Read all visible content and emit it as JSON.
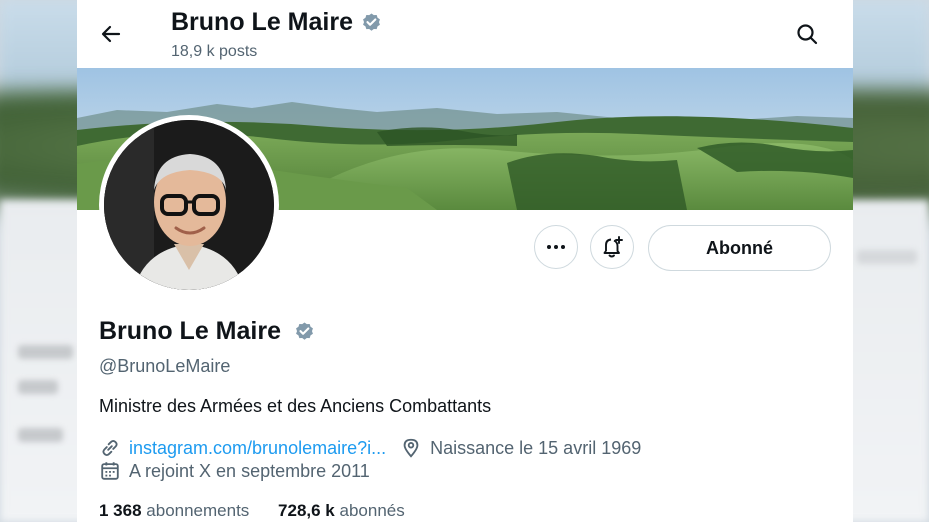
{
  "header": {
    "title": "Bruno Le Maire",
    "posts_count": "18,9 k posts"
  },
  "actions": {
    "follow_label": "Abonné"
  },
  "profile": {
    "name": "Bruno Le Maire",
    "handle": "@BrunoLeMaire",
    "bio": "Ministre des Armées et des Anciens Combattants",
    "link_text": "instagram.com/brunolemaire?i...",
    "birth": "Naissance le 15 avril 1969",
    "joined": "A rejoint X en septembre 2011"
  },
  "stats": {
    "following_count": "1 368",
    "following_label": "abonnements",
    "followers_count": "728,6 k",
    "followers_label": "abonnés"
  },
  "icons": {
    "back": "arrow-left-icon",
    "search": "search-icon",
    "verified": "verified-badge-icon",
    "more": "more-icon",
    "notify": "bell-plus-icon",
    "link": "link-icon",
    "location": "location-pin-icon",
    "calendar": "calendar-icon"
  },
  "colors": {
    "text": "#0f1419",
    "secondary": "#536471",
    "link": "#1d9bf0",
    "verified": "#829aab",
    "border": "#cfd9de"
  }
}
